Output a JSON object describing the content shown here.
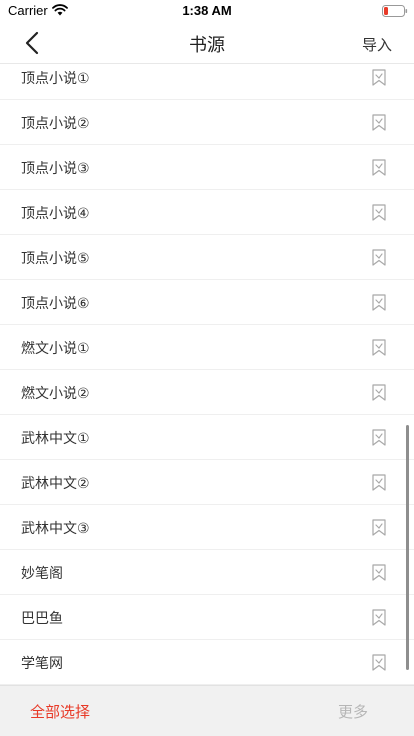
{
  "status_bar": {
    "carrier": "Carrier",
    "time": "1:38 AM",
    "battery_color": "#e83a28"
  },
  "nav": {
    "title": "书源",
    "import_label": "导入"
  },
  "sources": [
    {
      "name": "顶点小说①"
    },
    {
      "name": "顶点小说②"
    },
    {
      "name": "顶点小说③"
    },
    {
      "name": "顶点小说④"
    },
    {
      "name": "顶点小说⑤"
    },
    {
      "name": "顶点小说⑥"
    },
    {
      "name": "燃文小说①"
    },
    {
      "name": "燃文小说②"
    },
    {
      "name": "武林中文①"
    },
    {
      "name": "武林中文②"
    },
    {
      "name": "武林中文③"
    },
    {
      "name": "妙笔阁"
    },
    {
      "name": "巴巴鱼"
    },
    {
      "name": "学笔网"
    }
  ],
  "footer": {
    "select_all_label": "全部选择",
    "more_label": "更多"
  },
  "colors": {
    "accent": "#e83a28",
    "disabled": "#b6b6b6"
  }
}
